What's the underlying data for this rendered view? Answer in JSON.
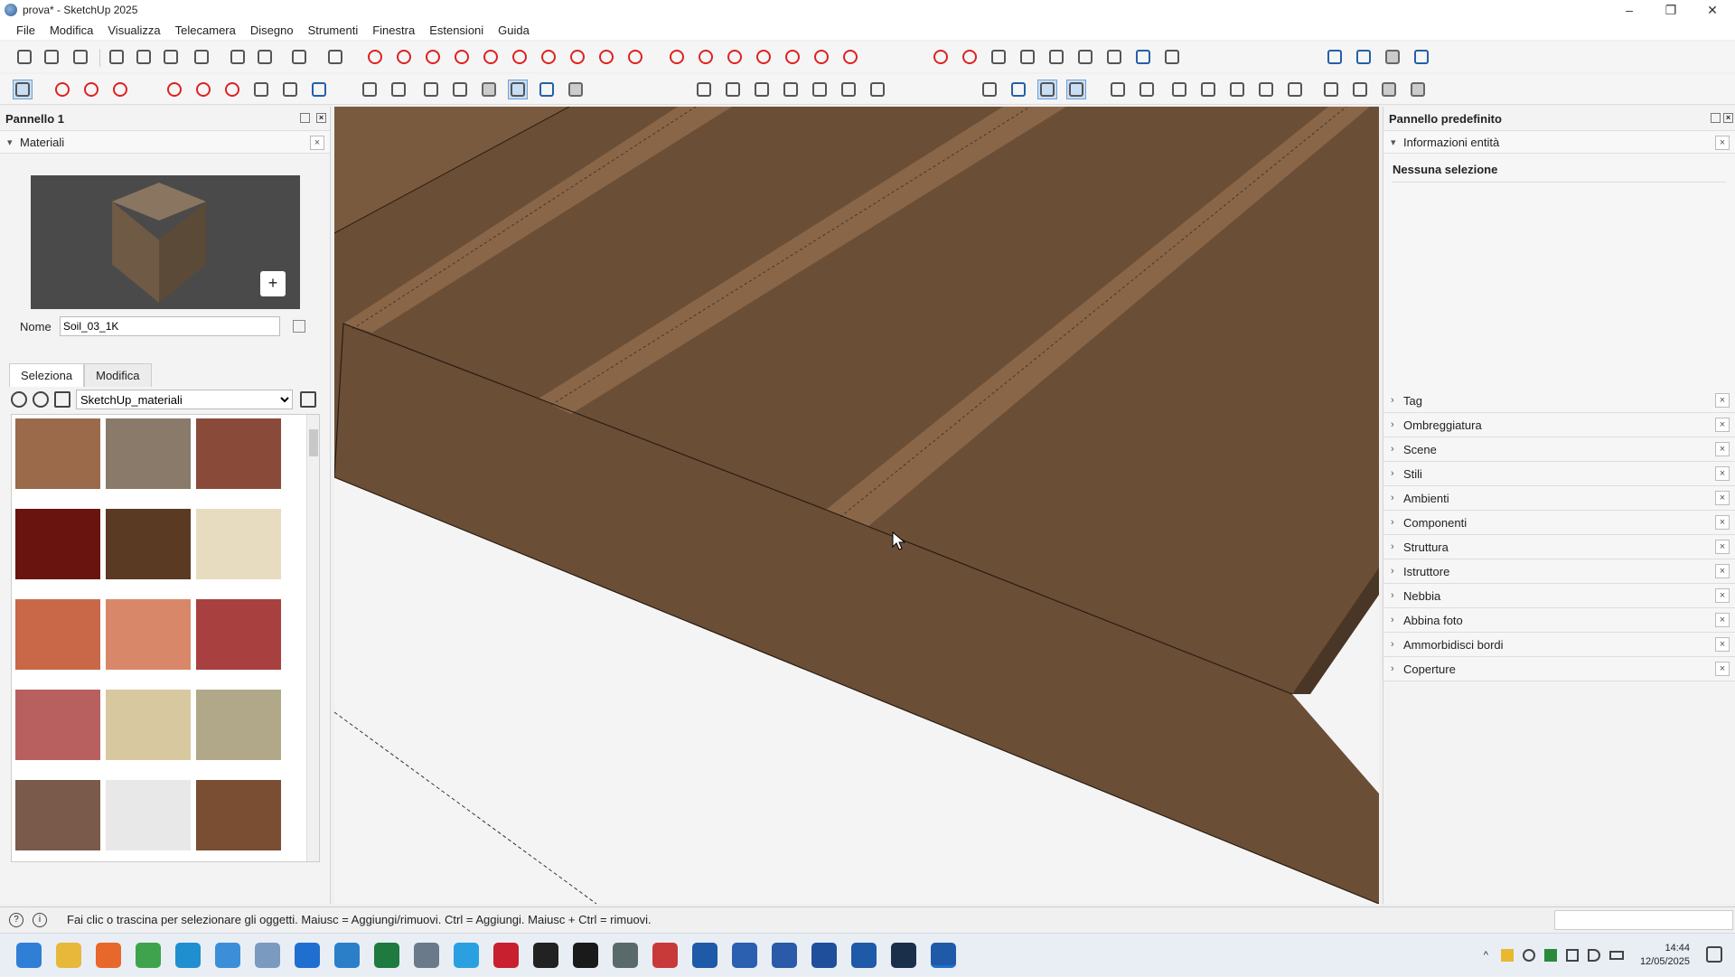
{
  "window": {
    "title": "prova* - SketchUp 2025",
    "controls": {
      "minimize": "–",
      "maximize": "❐",
      "close": "✕"
    }
  },
  "menu": [
    "File",
    "Modifica",
    "Visualizza",
    "Telecamera",
    "Disegno",
    "Strumenti",
    "Finestra",
    "Estensioni",
    "Guida"
  ],
  "left_panel": {
    "title": "Pannello 1",
    "materials_section": "Materiali",
    "add_icon": "+",
    "name_label": "Nome",
    "name_value": "Soil_03_1K",
    "tabs": [
      "Seleziona",
      "Modifica"
    ],
    "library": "SketchUp_materiali",
    "swatch_colors": [
      "#9a6a4a",
      "#8a7a6a",
      "#8a4a3a",
      "#6a1410",
      "#5a3a22",
      "#e8dcc0",
      "#c86848",
      "#d88868",
      "#a84040",
      "#b86060",
      "#d8c8a0",
      "#b0a888",
      "#7a5a4a",
      "#e8e8e8",
      "#7a4e32"
    ]
  },
  "right_panel": {
    "title": "Pannello predefinito",
    "entity_info": "Informazioni entità",
    "no_selection": "Nessuna selezione",
    "trays": [
      "Tag",
      "Ombreggiatura",
      "Scene",
      "Stili",
      "Ambienti",
      "Componenti",
      "Struttura",
      "Istruttore",
      "Nebbia",
      "Abbina foto",
      "Ammorbidisci bordi",
      "Coperture"
    ]
  },
  "status": {
    "message": "Fai clic o trascina per selezionare gli oggetti. Maiusc = Aggiungi/rimuovi. Ctrl = Aggiungi. Maiusc + Ctrl = rimuovi."
  },
  "taskbar": {
    "time": "14:44",
    "date": "12/05/2025"
  },
  "icons": {
    "panel_chevron": "chevron-down-icon",
    "tray_chevron": "chevron-right-icon",
    "close": "close-icon"
  }
}
